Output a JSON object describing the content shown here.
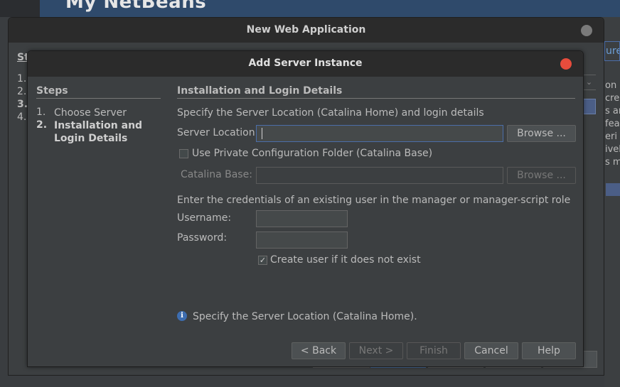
{
  "background": {
    "ide_title": "My NetBeans",
    "right_field_text": "ure",
    "right_texts": [
      "on",
      "cre",
      "s an",
      "fea",
      "eri",
      "ivel",
      "s ma"
    ]
  },
  "outer_window": {
    "title": "New Web Application",
    "steps_heading": "St",
    "steps": [
      "1.",
      "2.",
      "3.",
      "4."
    ]
  },
  "dialog": {
    "title": "Add Server Instance",
    "steps_heading": "Steps",
    "steps": [
      {
        "number": "1.",
        "label_line1": "Choose Server",
        "label_line2": ""
      },
      {
        "number": "2.",
        "label_line1": "Installation and",
        "label_line2": "Login Details"
      }
    ],
    "section_heading": "Installation and Login Details",
    "intro_text": "Specify the Server Location (Catalina Home) and login details",
    "server_location_label": "Server Location:",
    "server_location_value": "",
    "browse_label": "Browse ...",
    "private_config_label": "Use Private Configuration Folder (Catalina Base)",
    "private_config_checked": false,
    "catalina_base_label": "Catalina Base:",
    "catalina_base_value": "",
    "browse2_label": "Browse ...",
    "credentials_text": "Enter the credentials of an existing user in the manager or manager-script role",
    "username_label": "Username:",
    "username_value": "",
    "password_label": "Password:",
    "password_value": "",
    "create_user_label": "Create user if it does not exist",
    "create_user_checked": true,
    "info_message": "Specify the Server Location (Catalina Home).",
    "buttons": {
      "back": "< Back",
      "next": "Next >",
      "finish": "Finish",
      "cancel": "Cancel",
      "help": "Help"
    }
  },
  "colors": {
    "close_active": "#e74c3c",
    "focus_border": "#4b6ea9",
    "info_icon": "#3d6db0"
  }
}
